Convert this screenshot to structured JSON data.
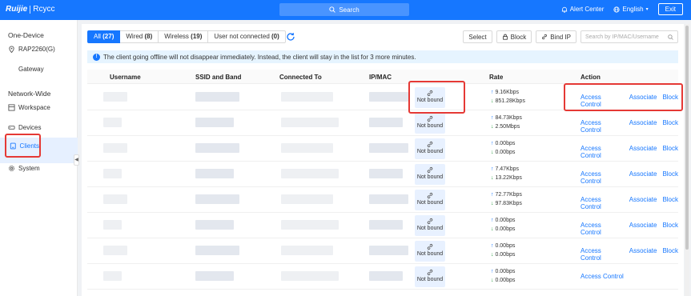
{
  "topbar": {
    "brand": "Ruijie",
    "product": "Rcycc",
    "search_label": "Search",
    "alert_center": "Alert Center",
    "language": "English",
    "exit": "Exit"
  },
  "sidebar": {
    "one_device_label": "One-Device",
    "device_model": "RAP2260(G)",
    "gateway": "Gateway",
    "network_wide_label": "Network-Wide",
    "workspace": "Workspace",
    "devices": "Devices",
    "clients": "Clients",
    "system": "System"
  },
  "tabs": [
    {
      "label": "All",
      "count": "(27)"
    },
    {
      "label": "Wired",
      "count": "(8)"
    },
    {
      "label": "Wireless",
      "count": "(19)"
    },
    {
      "label": "User not connected",
      "count": "(0)"
    }
  ],
  "toolbar": {
    "select": "Select",
    "block": "Block",
    "bind_ip": "Bind IP",
    "search_placeholder": "Search by IP/MAC/Username"
  },
  "notice": "The client going offline will not disappear immediately. Instead, the client will stay in the list for 3 more minutes.",
  "table": {
    "columns": [
      "Username",
      "SSID and Band",
      "Connected To",
      "IP/MAC",
      "Rate",
      "Action"
    ],
    "not_bound_label": "Not bound",
    "rows": [
      {
        "up": "9.16Kbps",
        "down": "851.28Kbps",
        "actions": [
          "Access Control",
          "Associate",
          "Block"
        ]
      },
      {
        "up": "84.73Kbps",
        "down": "2.50Mbps",
        "actions": [
          "Access Control",
          "Associate",
          "Block"
        ]
      },
      {
        "up": "0.00bps",
        "down": "0.00bps",
        "actions": [
          "Access Control",
          "Associate",
          "Block"
        ]
      },
      {
        "up": "7.47Kbps",
        "down": "13.22Kbps",
        "actions": [
          "Access Control",
          "Associate",
          "Block"
        ]
      },
      {
        "up": "72.77Kbps",
        "down": "97.83Kbps",
        "actions": [
          "Access Control",
          "Associate",
          "Block"
        ]
      },
      {
        "up": "0.00bps",
        "down": "0.00bps",
        "actions": [
          "Access Control",
          "Associate",
          "Block"
        ]
      },
      {
        "up": "0.00bps",
        "down": "0.00bps",
        "actions": [
          "Access Control",
          "Associate",
          "Block"
        ]
      },
      {
        "up": "0.00bps",
        "down": "0.00bps",
        "actions": [
          "Access Control"
        ]
      }
    ]
  },
  "colors": {
    "primary": "#1677ff",
    "highlight": "#e53935",
    "download": "#2e9e45"
  }
}
